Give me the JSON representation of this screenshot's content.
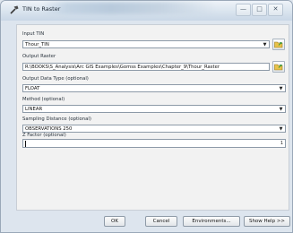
{
  "window": {
    "title": "TIN to Raster",
    "caption_minimize": "—",
    "caption_maximize": "□",
    "caption_close": "✕"
  },
  "form": {
    "input_tin_label": "Input TIN",
    "input_tin_value": "Thour_TIN",
    "output_raster_label": "Output Raster",
    "output_raster_value": "R:\\BOOKS\\S_Analysis\\Arc GIS Examples\\Gomss Examples\\Chapter_9\\Thour_Raster",
    "data_type_label": "Output Data Type (optional)",
    "data_type_value": "FLOAT",
    "method_label": "Method (optional)",
    "method_value": "LINEAR",
    "sampling_label": "Sampling Distance (optional)",
    "sampling_value": "OBSERVATIONS 250",
    "zfactor_label": "Z Factor (optional)",
    "zfactor_value": "1"
  },
  "buttons": {
    "ok": "OK",
    "cancel": "Cancel",
    "environments": "Environments...",
    "show_help": "Show Help >>"
  },
  "icons": {
    "app": "hammer-icon",
    "browse": "open-folder-icon",
    "dropdown": "chevron-down-icon"
  },
  "colors": {
    "folder_yellow": "#e8c24a",
    "folder_green": "#3a9a3a"
  }
}
